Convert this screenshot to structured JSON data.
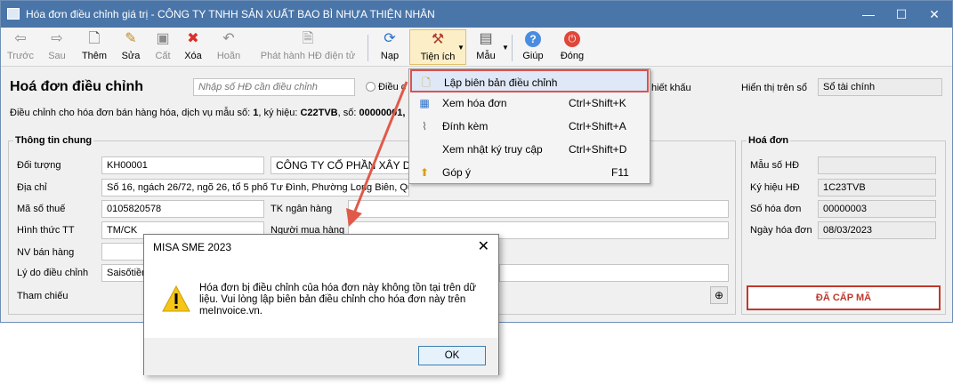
{
  "window": {
    "title": "Hóa đơn điều chỉnh giá trị - CÔNG TY TNHH SẢN XUẤT BAO BÌ NHỰA THIỆN NHÂN",
    "minimize": "—",
    "maximize": "☐",
    "close": "✕"
  },
  "toolbar": {
    "prev": "Trước",
    "next": "Sau",
    "add": "Thêm",
    "edit": "Sửa",
    "save": "Cất",
    "delete": "Xóa",
    "undo": "Hoãn",
    "publish": "Phát hành HĐ điện tử",
    "load": "Nạp",
    "utilities": "Tiện ích",
    "template": "Mẫu",
    "help": "Giúp",
    "close": "Đóng"
  },
  "header": {
    "page_title": "Hoá đơn điều chỉnh",
    "invoice_search_placeholder": "Nhập số HĐ cần điều chỉnh",
    "radio_adjust_label": "Điều c",
    "discount_label": "hiết khấu",
    "display_label": "Hiển thị trên sổ",
    "display_value": "Sổ tài chính",
    "description_prefix": "Điều chỉnh cho hóa đơn bán hàng hóa, dịch vụ mẫu số: ",
    "description_template": "1",
    "description_mid": ", ký hiệu: ",
    "description_symbol": "C22TVB",
    "description_mid2": ", số: ",
    "description_number": "00000001,"
  },
  "general_info": {
    "title": "Thông tin chung",
    "customer_label": "Đối tượng",
    "customer_code": "KH00001",
    "customer_name": "CÔNG TY CỔ PHẦN XÂY DỰ",
    "address_label": "Địa chỉ",
    "address_value": "Số 16, ngách 26/72, ngõ 26, tổ 5 phố Tư Đình, Phường Long Biên, Quận Long Biên, Thành phố Hà Nội, Việt Nam",
    "tax_code_label": "Mã số thuế",
    "tax_code_value": "0105820578",
    "bank_account_label": "TK ngân hàng",
    "payment_method_label": "Hình thức TT",
    "payment_method_value": "TM/CK",
    "buyer_label": "Người mua hàng",
    "salesperson_label": "NV bán hàng",
    "reason_label": "Lý do điều chỉnh",
    "reason_value": "Saisốtiền",
    "reference_label": "Tham chiếu"
  },
  "invoice_info": {
    "title": "Hoá đơn",
    "template_label": "Mẫu số HĐ",
    "template_value": "",
    "symbol_label": "Ký hiệu HĐ",
    "symbol_value": "1C23TVB",
    "number_label": "Số hóa đơn",
    "number_value": "00000003",
    "date_label": "Ngày hóa đơn",
    "date_value": "08/03/2023",
    "status": "ĐÃ CẤP MÃ"
  },
  "menu": {
    "items": [
      {
        "label": "Lập biên bản điều chỉnh",
        "shortcut": "",
        "icon": "document-star-icon"
      },
      {
        "label": "Xem hóa đơn",
        "shortcut": "Ctrl+Shift+K",
        "icon": "view-invoice-icon"
      },
      {
        "label": "Đính kèm",
        "shortcut": "Ctrl+Shift+A",
        "icon": "paperclip-icon"
      },
      {
        "label": "Xem nhật ký truy cập",
        "shortcut": "Ctrl+Shift+D",
        "icon": ""
      },
      {
        "label": "Góp ý",
        "shortcut": "F11",
        "icon": "feedback-icon"
      }
    ]
  },
  "dialog": {
    "title": "MISA SME 2023",
    "close": "✕",
    "message": "Hóa đơn bị điều chỉnh của hóa đơn này không tồn tại trên dữ liệu. Vui lòng lập biên bản điều chỉnh cho hóa đơn này trên meInvoice.vn.",
    "ok": "OK"
  },
  "colors": {
    "titlebar": "#4a75a8",
    "highlight_border": "#d9534f",
    "status_red": "#c0392b",
    "arrow": "#e05a4a"
  }
}
